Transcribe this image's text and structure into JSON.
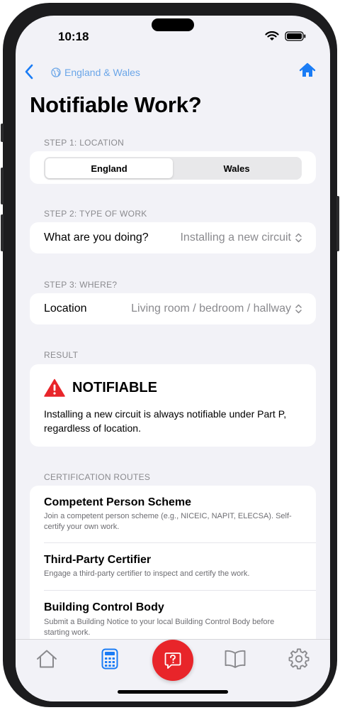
{
  "status": {
    "time": "10:18"
  },
  "nav": {
    "region_label": "England & Wales",
    "back_icon": "chevron-left-icon",
    "home_icon": "house-icon"
  },
  "page": {
    "title": "Notifiable Work?"
  },
  "step1": {
    "label": "STEP 1: LOCATION",
    "options": [
      "England",
      "Wales"
    ],
    "selected": "England"
  },
  "step2": {
    "label": "STEP 2: TYPE OF WORK",
    "field_label": "What are you doing?",
    "value": "Installing a new circuit"
  },
  "step3": {
    "label": "STEP 3: WHERE?",
    "field_label": "Location",
    "value": "Living room / bedroom / hallway"
  },
  "result": {
    "label": "RESULT",
    "title": "NOTIFIABLE",
    "text": "Installing a new circuit is always notifiable under Part P, regardless of location.",
    "color": "#e8252a"
  },
  "routes": {
    "label": "CERTIFICATION ROUTES",
    "items": [
      {
        "title": "Competent Person Scheme",
        "desc": "Join a competent person scheme (e.g., NICEIC, NAPIT, ELECSA). Self-certify your own work."
      },
      {
        "title": "Third-Party Certifier",
        "desc": "Engage a third-party certifier to inspect and certify the work."
      },
      {
        "title": "Building Control Body",
        "desc": "Submit a Building Notice to your local Building Control Body before starting work."
      }
    ]
  },
  "tabbar": {
    "tabs": [
      "house-icon",
      "calculator-icon",
      "question-icon",
      "book-icon",
      "gear-icon"
    ],
    "active": "calculator-icon"
  },
  "colors": {
    "accent": "#1a7cf5",
    "link": "#6ba6e8",
    "danger": "#e8252a",
    "background": "#f2f2f7"
  }
}
